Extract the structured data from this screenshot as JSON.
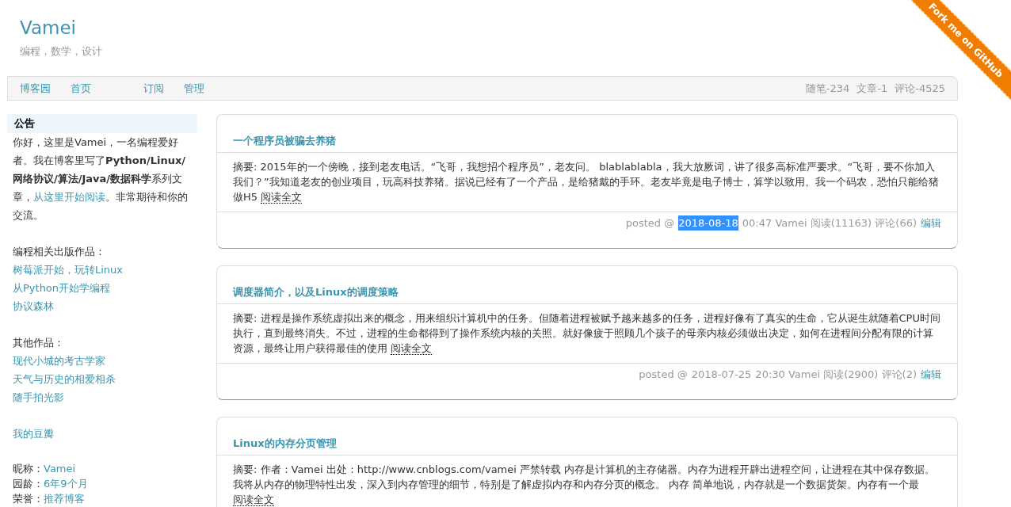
{
  "header": {
    "title": "Vamei",
    "subtitle": "编程，数学，设计"
  },
  "nav": {
    "links": [
      "博客园",
      "首页",
      "订阅",
      "管理"
    ],
    "stats": [
      "随笔-234",
      "文章-1",
      "评论-4525"
    ]
  },
  "ribbon": "Fork me on GitHub",
  "sidebar": {
    "notice_title": "公告",
    "notice_text": "你好，这里是Vamei，一名编程爱好者。我在博客里写了**Python/Linux/网络协议/算法/Java/数据科学**系列文章，",
    "notice_link": "从这里开始阅读",
    "notice_tail": "。非常期待和你的交流。",
    "sections": [
      {
        "heading": "编程相关出版作品：",
        "links": [
          "树莓派开始，玩转Linux",
          "从Python开始学编程",
          "协议森林"
        ]
      },
      {
        "heading": "其他作品：",
        "links": [
          "现代小城的考古学家",
          "天气与历史的相爱相杀",
          "随手拍光影"
        ]
      },
      {
        "links": [
          "我的豆瓣"
        ]
      }
    ],
    "info": [
      {
        "label": "昵称：",
        "value": "Vamei"
      },
      {
        "label": "园龄：",
        "value": "6年9个月"
      },
      {
        "label": "荣誉：",
        "value": "推荐博客"
      }
    ]
  },
  "posts": [
    {
      "title": "一个程序员被骗去养猪",
      "summary": "摘要: 2015年的一个傍晚，接到老友电话。“飞哥，我想招个程序员”，老友问。 blablablabla，我大放厥词，讲了很多高标准严要求。“飞哥，要不你加入我们？”我知道老友的创业项目，玩高科技养猪。据说已经有了一个产品，是给猪戴的手环。老友毕竟是电子博士，算学以致用。我一个码农，恐怕只能给猪做H5",
      "read_more": "阅读全文",
      "posted": "posted @",
      "date": "2018-08-18",
      "date_selected": true,
      "meta": "00:47 Vamei 阅读(11163) 评论(66)",
      "edit": "编辑"
    },
    {
      "title": "调度器简介，以及Linux的调度策略",
      "summary": "摘要: 进程是操作系统虚拟出来的概念，用来组织计算机中的任务。但随着进程被赋予越来越多的任务，进程好像有了真实的生命，它从诞生就随着CPU时间执行，直到最终消失。不过，进程的生命都得到了操作系统内核的关照。就好像疲于照顾几个孩子的母亲内核必须做出决定，如何在进程间分配有限的计算资源，最终让用户获得最佳的使用",
      "read_more": "阅读全文",
      "posted": "posted @",
      "date": "2018-07-25",
      "date_selected": false,
      "meta": "20:30 Vamei 阅读(2900) 评论(2)",
      "edit": "编辑"
    },
    {
      "title": "Linux的内存分页管理",
      "summary": "摘要: 作者：Vamei 出处：http://www.cnblogs.com/vamei 严禁转载 内存是计算机的主存储器。内存为进程开辟出进程空间，让进程在其中保存数据。我将从内存的物理特性出发，深入到内存管理的细节，特别是了解虚拟内存和内存分页的概念。 内存 简单地说，内存就是一个数据货架。内存有一个最",
      "read_more": "阅读全文"
    }
  ]
}
